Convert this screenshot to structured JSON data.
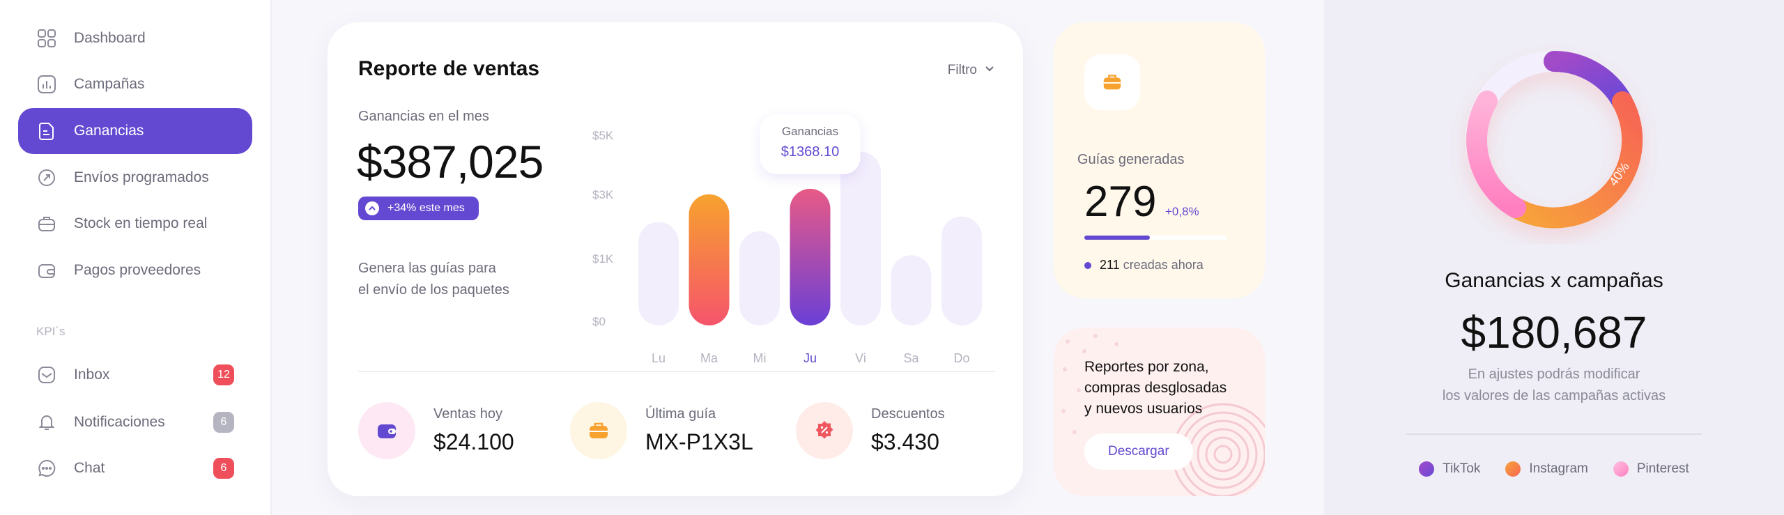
{
  "sidebar": {
    "items": [
      {
        "label": "Dashboard",
        "icon": "dashboard-icon"
      },
      {
        "label": "Campañas",
        "icon": "bar-chart-icon"
      },
      {
        "label": "Ganancias",
        "icon": "document-icon",
        "active": true
      },
      {
        "label": "Envíos programados",
        "icon": "gauge-icon"
      },
      {
        "label": "Stock en tiempo real",
        "icon": "box-icon"
      },
      {
        "label": "Pagos proveedores",
        "icon": "wallet-icon"
      }
    ],
    "section_label": "KPI´s",
    "kpi_items": [
      {
        "label": "Inbox",
        "icon": "inbox-icon",
        "badge": "12"
      },
      {
        "label": "Notificaciones",
        "icon": "bell-icon",
        "badge": "6"
      },
      {
        "label": "Chat",
        "icon": "chat-icon",
        "badge": "6"
      }
    ]
  },
  "sales": {
    "title": "Reporte de ventas",
    "filter_label": "Filtro",
    "month_label": "Ganancias en el mes",
    "month_value": "$387,025",
    "pill_label": "+34% este mes",
    "desc_line1": "Genera las guías para",
    "desc_line2": "el envío de los paquetes",
    "stats": [
      {
        "label": "Ventas hoy",
        "value": "$24.100",
        "icon": "wallet-icon"
      },
      {
        "label": "Última guía",
        "value": "MX-P1X3L",
        "icon": "briefcase-icon"
      },
      {
        "label": "Descuentos",
        "value": "$3.430",
        "icon": "discount-icon"
      }
    ]
  },
  "chart_data": {
    "type": "bar",
    "categories": [
      "Lu",
      "Ma",
      "Mi",
      "Ju",
      "Vi",
      "Sa",
      "Do"
    ],
    "values": [
      2800,
      3550,
      2550,
      3700,
      4700,
      1900,
      2950
    ],
    "highlighted": [
      "Ma",
      "Ju"
    ],
    "y_ticks": [
      "$0",
      "$1K",
      "$3K",
      "$5K"
    ],
    "ylim": [
      0,
      5000
    ],
    "tooltip": {
      "category": "Ju",
      "label": "Ganancias",
      "value": "$1368.10"
    }
  },
  "guias": {
    "label": "Guías generadas",
    "value": "279",
    "delta": "+0,8%",
    "progress": 0.46,
    "created_count": "211",
    "created_label": "creadas ahora"
  },
  "reportes": {
    "line1": "Reportes por zona,",
    "line2": "compras desglosadas",
    "line3": "y nuevos usuarios",
    "button_label": "Descargar"
  },
  "campaigns": {
    "title": "Ganancias x campañas",
    "value": "$180,687",
    "desc_line1": "En ajustes podrás modificar",
    "desc_line2": "los valores de las campañas activas",
    "donut_label": "40%",
    "legend": [
      {
        "name": "TikTok",
        "color": "#7a4fd8"
      },
      {
        "name": "Instagram",
        "color": "#f79a3a"
      },
      {
        "name": "Pinterest",
        "color": "#ff8fc8"
      }
    ]
  }
}
